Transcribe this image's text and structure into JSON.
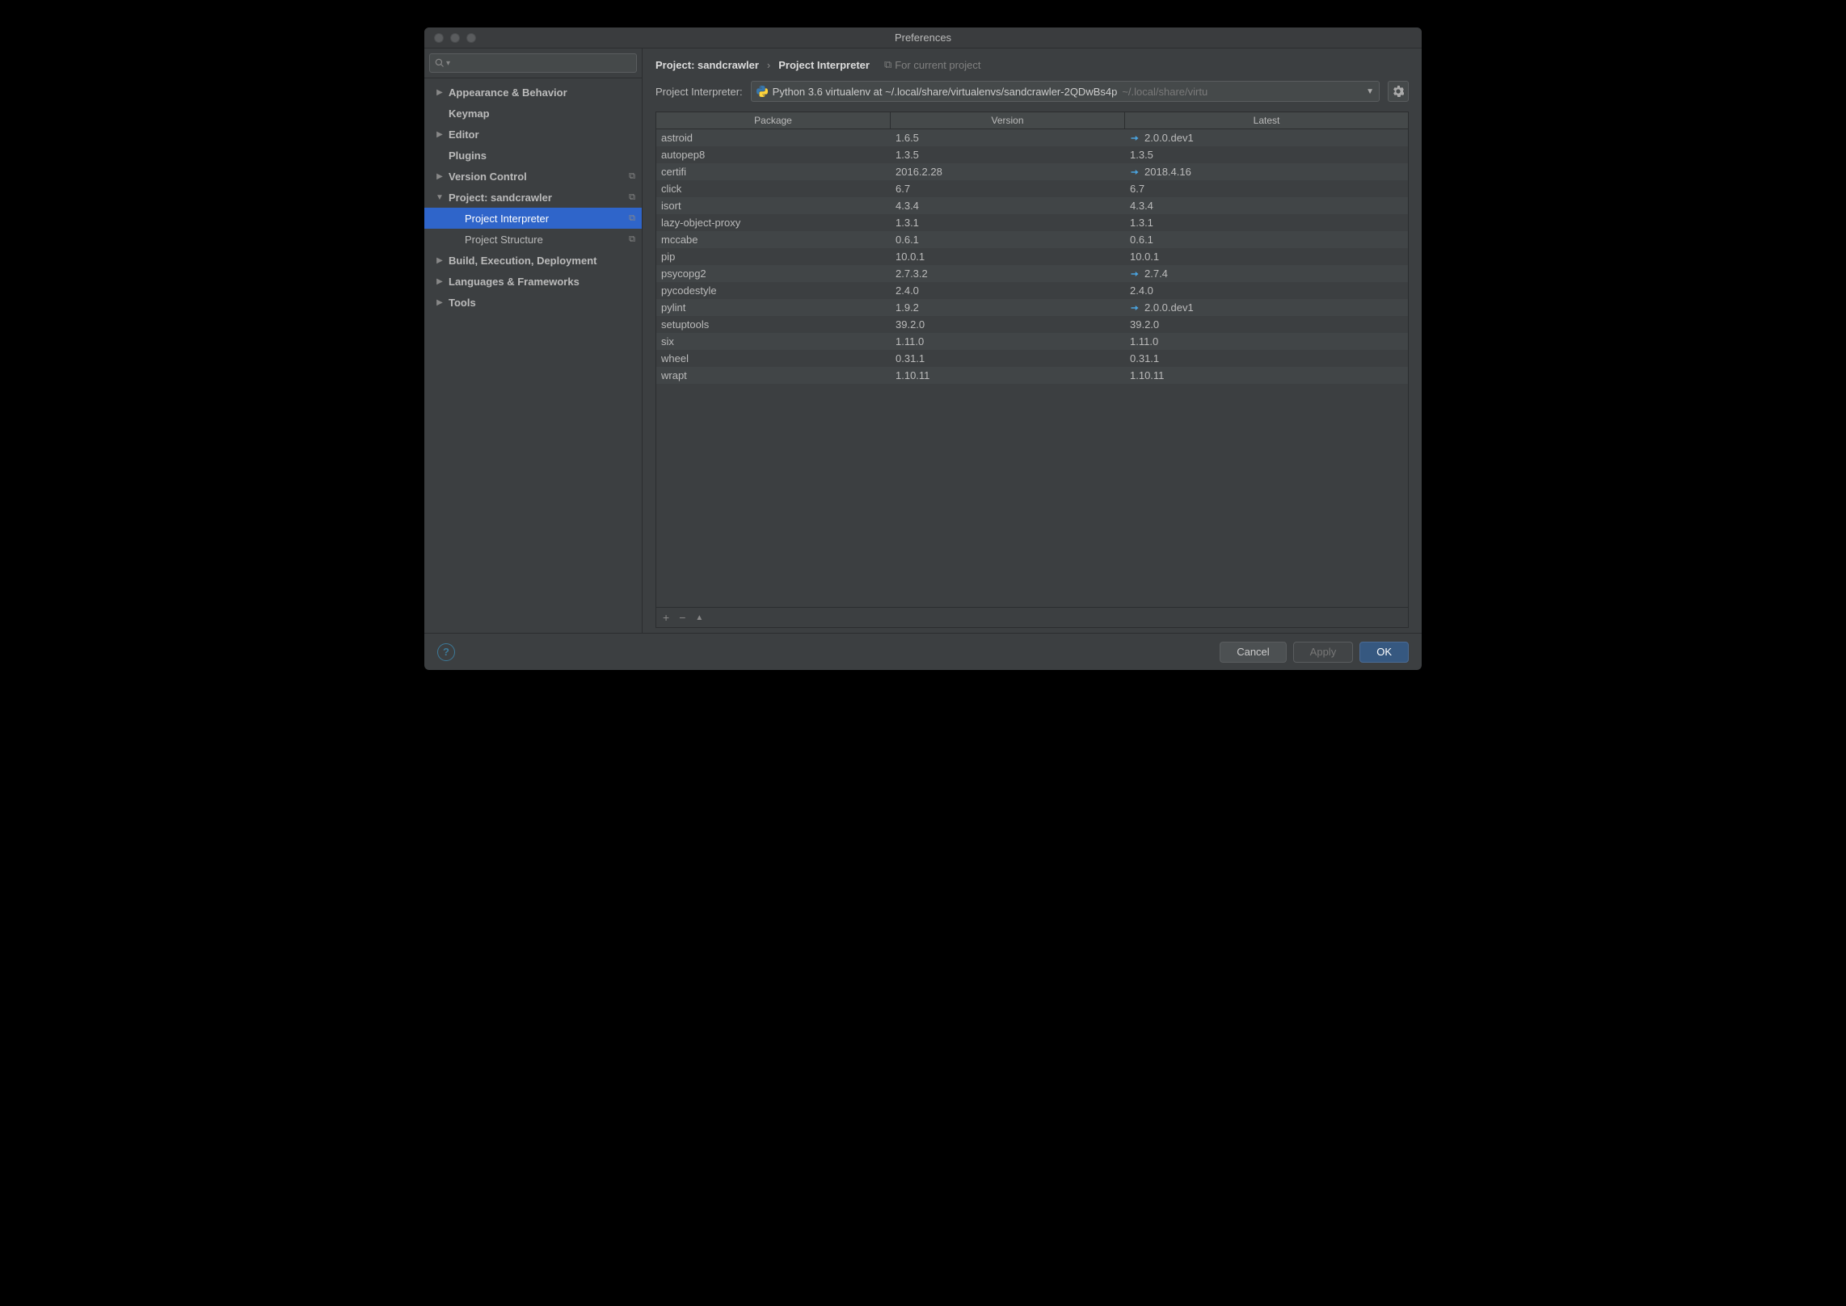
{
  "window": {
    "title": "Preferences"
  },
  "sidebar": {
    "search_placeholder": "",
    "items": [
      {
        "label": "Appearance & Behavior",
        "bold": true,
        "arrow": "▶",
        "child": false,
        "selected": false,
        "copy": false
      },
      {
        "label": "Keymap",
        "bold": true,
        "arrow": "",
        "child": false,
        "selected": false,
        "copy": false
      },
      {
        "label": "Editor",
        "bold": true,
        "arrow": "▶",
        "child": false,
        "selected": false,
        "copy": false
      },
      {
        "label": "Plugins",
        "bold": true,
        "arrow": "",
        "child": false,
        "selected": false,
        "copy": false
      },
      {
        "label": "Version Control",
        "bold": true,
        "arrow": "▶",
        "child": false,
        "selected": false,
        "copy": true
      },
      {
        "label": "Project: sandcrawler",
        "bold": true,
        "arrow": "▼",
        "child": false,
        "selected": false,
        "copy": true
      },
      {
        "label": "Project Interpreter",
        "bold": false,
        "arrow": "",
        "child": true,
        "selected": true,
        "copy": true
      },
      {
        "label": "Project Structure",
        "bold": false,
        "arrow": "",
        "child": true,
        "selected": false,
        "copy": true
      },
      {
        "label": "Build, Execution, Deployment",
        "bold": true,
        "arrow": "▶",
        "child": false,
        "selected": false,
        "copy": false
      },
      {
        "label": "Languages & Frameworks",
        "bold": true,
        "arrow": "▶",
        "child": false,
        "selected": false,
        "copy": false
      },
      {
        "label": "Tools",
        "bold": true,
        "arrow": "▶",
        "child": false,
        "selected": false,
        "copy": false
      }
    ]
  },
  "breadcrumb": {
    "crumb1": "Project: sandcrawler",
    "crumb2": "Project Interpreter",
    "scope": "For current project"
  },
  "interpreter": {
    "label": "Project Interpreter:",
    "value": "Python 3.6 virtualenv at ~/.local/share/virtualenvs/sandcrawler-2QDwBs4p",
    "path_hint": "~/.local/share/virtu"
  },
  "table": {
    "headers": {
      "package": "Package",
      "version": "Version",
      "latest": "Latest"
    },
    "rows": [
      {
        "package": "astroid",
        "version": "1.6.5",
        "latest": "2.0.0.dev1",
        "upgrade": true
      },
      {
        "package": "autopep8",
        "version": "1.3.5",
        "latest": "1.3.5",
        "upgrade": false
      },
      {
        "package": "certifi",
        "version": "2016.2.28",
        "latest": "2018.4.16",
        "upgrade": true
      },
      {
        "package": "click",
        "version": "6.7",
        "latest": "6.7",
        "upgrade": false
      },
      {
        "package": "isort",
        "version": "4.3.4",
        "latest": "4.3.4",
        "upgrade": false
      },
      {
        "package": "lazy-object-proxy",
        "version": "1.3.1",
        "latest": "1.3.1",
        "upgrade": false
      },
      {
        "package": "mccabe",
        "version": "0.6.1",
        "latest": "0.6.1",
        "upgrade": false
      },
      {
        "package": "pip",
        "version": "10.0.1",
        "latest": "10.0.1",
        "upgrade": false
      },
      {
        "package": "psycopg2",
        "version": "2.7.3.2",
        "latest": "2.7.4",
        "upgrade": true
      },
      {
        "package": "pycodestyle",
        "version": "2.4.0",
        "latest": "2.4.0",
        "upgrade": false
      },
      {
        "package": "pylint",
        "version": "1.9.2",
        "latest": "2.0.0.dev1",
        "upgrade": true
      },
      {
        "package": "setuptools",
        "version": "39.2.0",
        "latest": "39.2.0",
        "upgrade": false
      },
      {
        "package": "six",
        "version": "1.11.0",
        "latest": "1.11.0",
        "upgrade": false
      },
      {
        "package": "wheel",
        "version": "0.31.1",
        "latest": "0.31.1",
        "upgrade": false
      },
      {
        "package": "wrapt",
        "version": "1.10.11",
        "latest": "1.10.11",
        "upgrade": false
      }
    ]
  },
  "toolbar": {
    "add": "+",
    "remove": "−",
    "up": "▲"
  },
  "footer": {
    "cancel": "Cancel",
    "apply": "Apply",
    "ok": "OK"
  }
}
